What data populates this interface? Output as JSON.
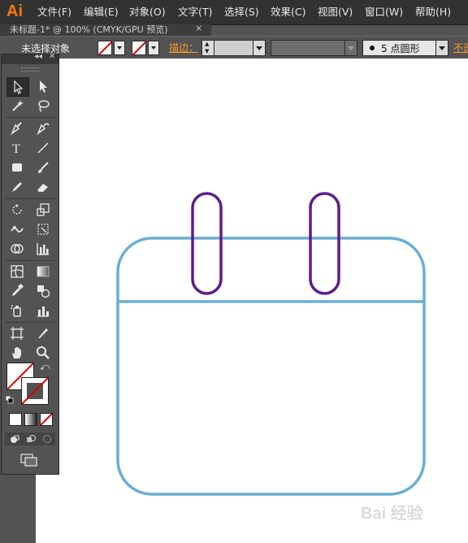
{
  "app": {
    "logo": "Ai"
  },
  "menubar": {
    "items": [
      "文件(F)",
      "编辑(E)",
      "对象(O)",
      "文字(T)",
      "选择(S)",
      "效果(C)",
      "视图(V)",
      "窗口(W)",
      "帮助(H)"
    ]
  },
  "document_tab": {
    "title": "未标题-1* @ 100% (CMYK/GPU 预览)",
    "close": "×"
  },
  "controlbar": {
    "selection_status": "未选择对象",
    "stroke_label": "描边：",
    "brush_value": "5",
    "brush_label": "点圆形",
    "opacity_label": "不透"
  },
  "tools_panel": {
    "collapse": "◂◂",
    "close": "✕",
    "tools": [
      "selection-tool",
      "direct-selection-tool",
      "magic-wand-tool",
      "lasso-tool",
      "pen-tool",
      "curvature-tool",
      "type-tool",
      "line-segment-tool",
      "rectangle-tool",
      "paintbrush-tool",
      "pencil-tool",
      "eraser-tool",
      "rotate-tool",
      "scale-tool",
      "warp-tool",
      "free-transform-tool",
      "shape-builder-tool",
      "graph-tool",
      "mesh-tool",
      "gradient-tool",
      "eyedropper-tool",
      "blend-tool",
      "symbol-sprayer-tool",
      "column-graph-tool",
      "artboard-tool",
      "slice-tool",
      "hand-tool",
      "zoom-tool"
    ]
  },
  "colors": {
    "calendar_stroke": "#6aaed2",
    "ring_stroke": "#5e1c8a",
    "accent_orange": "#ff9a2a",
    "none_red": "#d80000"
  },
  "watermark": {
    "text": "Bai 经验"
  }
}
